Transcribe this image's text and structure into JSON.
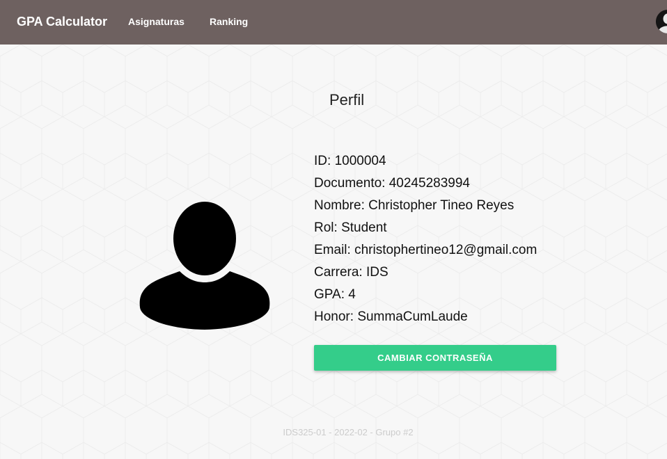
{
  "navbar": {
    "brand": "GPA Calculator",
    "links": [
      {
        "label": "Asignaturas"
      },
      {
        "label": "Ranking"
      }
    ],
    "avatar_icon": "user-avatar-icon",
    "background": "#6e6160"
  },
  "profile": {
    "title": "Perfil",
    "avatar_icon": "user-silhouette-icon",
    "fields": [
      {
        "label": "ID:",
        "value": "1000004"
      },
      {
        "label": "Documento:",
        "value": "40245283994"
      },
      {
        "label": "Nombre:",
        "value": "Christopher Tineo Reyes"
      },
      {
        "label": "Rol:",
        "value": "Student"
      },
      {
        "label": "Email:",
        "value": "christophertineo12@gmail.com"
      },
      {
        "label": "Carrera:",
        "value": "IDS"
      },
      {
        "label": "GPA:",
        "value": "4"
      },
      {
        "label": "Honor:",
        "value": "SummaCumLaude"
      }
    ],
    "change_password_label": "CAMBIAR CONTRASEÑA",
    "accent": "#34cd8a"
  },
  "footer": {
    "text": "IDS325-01 - 2022-02 - Grupo #2"
  }
}
